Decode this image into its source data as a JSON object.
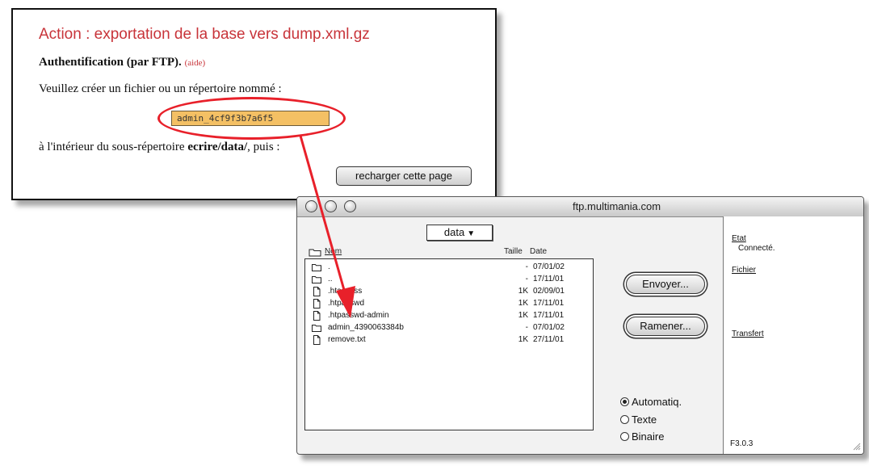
{
  "webpage": {
    "title": "Action : exportation de la base vers dump.xml.gz",
    "auth_label": "Authentification (par FTP).",
    "auth_help": "(aide)",
    "prompt": "Veuillez créer un fichier ou un répertoire nommé :",
    "field_value": "admin_4cf9f3b7a6f5",
    "inside_prefix": "à l'intérieur du sous-répertoire ",
    "inside_dir": "ecrire/data/",
    "inside_suffix": ", puis :",
    "reload_button": "recharger cette page"
  },
  "ftp": {
    "window_title": "ftp.multimania.com",
    "folder_popup": "data",
    "col_name": "Nom",
    "col_size": "Taille",
    "col_date": "Date",
    "files": [
      {
        "icon": "folder-icon",
        "name": ".",
        "size": "-",
        "date": "07/01/02"
      },
      {
        "icon": "folder-icon",
        "name": "..",
        "size": "-",
        "date": "17/11/01"
      },
      {
        "icon": "file-icon",
        "name": ".htaccess",
        "size": "1K",
        "date": "02/09/01"
      },
      {
        "icon": "file-icon",
        "name": ".htpasswd",
        "size": "1K",
        "date": "17/11/01"
      },
      {
        "icon": "file-icon",
        "name": ".htpasswd-admin",
        "size": "1K",
        "date": "17/11/01"
      },
      {
        "icon": "folder-icon",
        "name": "admin_4390063384b",
        "size": "-",
        "date": "07/01/02"
      },
      {
        "icon": "file-icon",
        "name": "remove.txt",
        "size": "1K",
        "date": "27/11/01"
      }
    ],
    "send_button": "Envoyer...",
    "fetch_button": "Ramener...",
    "modes": [
      {
        "label": "Automatiq.",
        "selected": true
      },
      {
        "label": "Texte",
        "selected": false
      },
      {
        "label": "Binaire",
        "selected": false
      }
    ],
    "status_label": "Etat",
    "status_value": "Connecté.",
    "file_label": "Fichier",
    "transfer_label": "Transfert",
    "version": "F3.0.3"
  },
  "colors": {
    "title_red": "#c8343a",
    "highlight_red": "#e8202a",
    "field_orange": "#f4c064"
  }
}
